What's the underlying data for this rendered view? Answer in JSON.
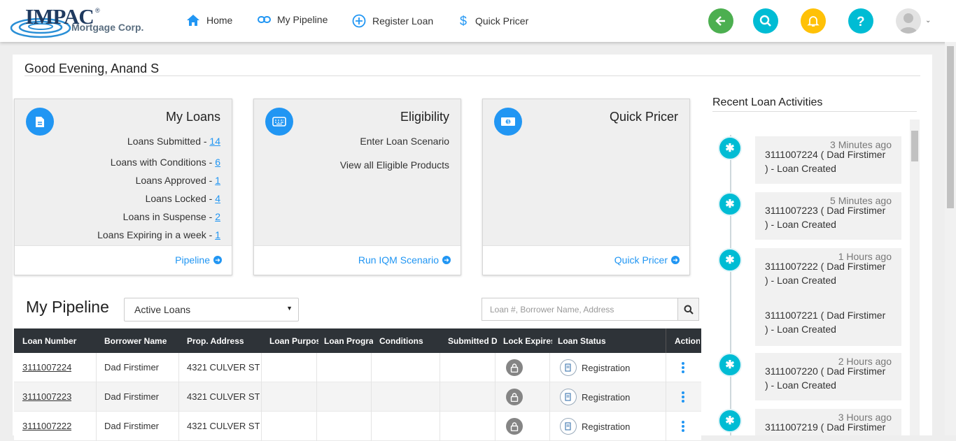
{
  "header": {
    "logo_text": "IMPAC",
    "logo_reg": "®",
    "logo_sub": "Mortgage Corp.",
    "nav": [
      {
        "label": "Home",
        "icon": "home-icon"
      },
      {
        "label": "My Pipeline",
        "icon": "link-icon"
      },
      {
        "label": "Register Loan",
        "icon": "plus-circle-icon"
      },
      {
        "label": "Quick Pricer",
        "icon": "dollar-icon"
      }
    ],
    "actions": [
      {
        "name": "back-button",
        "icon": "arrow-left-icon",
        "color": "#4caf50"
      },
      {
        "name": "search-button",
        "icon": "search-icon",
        "color": "#00bcd4"
      },
      {
        "name": "notifications-button",
        "icon": "bell-icon",
        "color": "#ffc107"
      },
      {
        "name": "help-button",
        "icon": "question-icon",
        "color": "#00bcd4"
      }
    ]
  },
  "greeting": "Good Evening, Anand S",
  "cards": {
    "my_loans": {
      "title": "My Loans",
      "rows": [
        {
          "label": "Loans Submitted - ",
          "count": "14"
        },
        {
          "label": "Loans with Conditions - ",
          "count": "6"
        },
        {
          "label": "Loans Approved - ",
          "count": "1"
        },
        {
          "label": "Loans Locked - ",
          "count": "4"
        },
        {
          "label": "Loans in Suspense - ",
          "count": "2"
        },
        {
          "label": "Loans Expiring in a week - ",
          "count": "1"
        }
      ],
      "link": "Pipeline"
    },
    "eligibility": {
      "title": "Eligibility",
      "rows": [
        "Enter Loan Scenario",
        "View all Eligible Products"
      ],
      "link": "Run IQM Scenario"
    },
    "quick_pricer": {
      "title": "Quick Pricer",
      "link": "Quick Pricer"
    }
  },
  "pipeline": {
    "title": "My Pipeline",
    "filter": "Active Loans",
    "search_placeholder": "Loan #, Borrower Name, Address",
    "columns": [
      "Loan Number",
      "Borrower Name",
      "Prop. Address",
      "Loan Purpos",
      "Loan Progra",
      "Conditions",
      "Submitted D",
      "Lock Expires",
      "Loan Status",
      "Action"
    ],
    "rows": [
      {
        "loan": "3111007224",
        "borrower": "Dad Firstimer",
        "address": "4321 CULVER ST",
        "status": "Registration"
      },
      {
        "loan": "3111007223",
        "borrower": "Dad Firstimer",
        "address": "4321 CULVER ST",
        "status": "Registration"
      },
      {
        "loan": "3111007222",
        "borrower": "Dad Firstimer",
        "address": "4321 CULVER ST",
        "status": "Registration"
      }
    ]
  },
  "activities": {
    "title": "Recent Loan Activities",
    "items": [
      {
        "ago": "3 Minutes ago",
        "line1": "3111007224 ( Dad Firstimer",
        "line2": ") - Loan Created"
      },
      {
        "ago": "5 Minutes ago",
        "line1": "3111007223 ( Dad Firstimer",
        "line2": ") - Loan Created"
      },
      {
        "ago": "1 Hours ago",
        "line1": "3111007222 ( Dad Firstimer",
        "line2": ") - Loan Created"
      },
      {
        "ago": "",
        "line1": "3111007221 ( Dad Firstimer",
        "line2": ") - Loan Created"
      },
      {
        "ago": "2 Hours ago",
        "line1": "3111007220 ( Dad Firstimer",
        "line2": ") - Loan Created"
      },
      {
        "ago": "3 Hours ago",
        "line1": "3111007219 ( Dad Firstimer",
        "line2": ""
      }
    ]
  }
}
